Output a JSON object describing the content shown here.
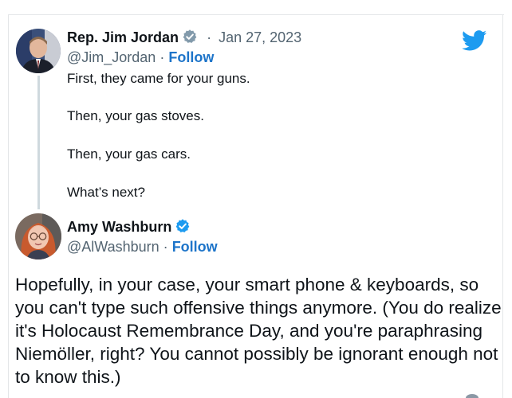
{
  "original_tweet": {
    "display_name": "Rep. Jim Jordan",
    "separator": "·",
    "date": "Jan 27, 2023",
    "handle": "@Jim_Jordan",
    "follow_label": "Follow",
    "lines": [
      "First, they came for your guns.",
      "Then, your gas stoves.",
      "Then, your gas cars.",
      "What’s next?"
    ]
  },
  "reply_tweet": {
    "display_name": "Amy Washburn",
    "handle": "@AlWashburn",
    "separator": "·",
    "follow_label": "Follow",
    "text": "Hopefully, in your case, your smart phone & keyboards, so you can't type such offensive things anymore. (You do realize it's Holocaust Remembrance Day, and you're paraphrasing Niemöller, right? You cannot possibly be ignorant enough not to know this.)"
  },
  "icons": {
    "brand": "twitter-bird-icon",
    "verified": "verified-badge-icon"
  },
  "colors": {
    "brand_blue": "#1d9bf0",
    "follow_blue": "#1d74c9",
    "muted_text": "#536471",
    "thread_line": "#cfd9de"
  }
}
